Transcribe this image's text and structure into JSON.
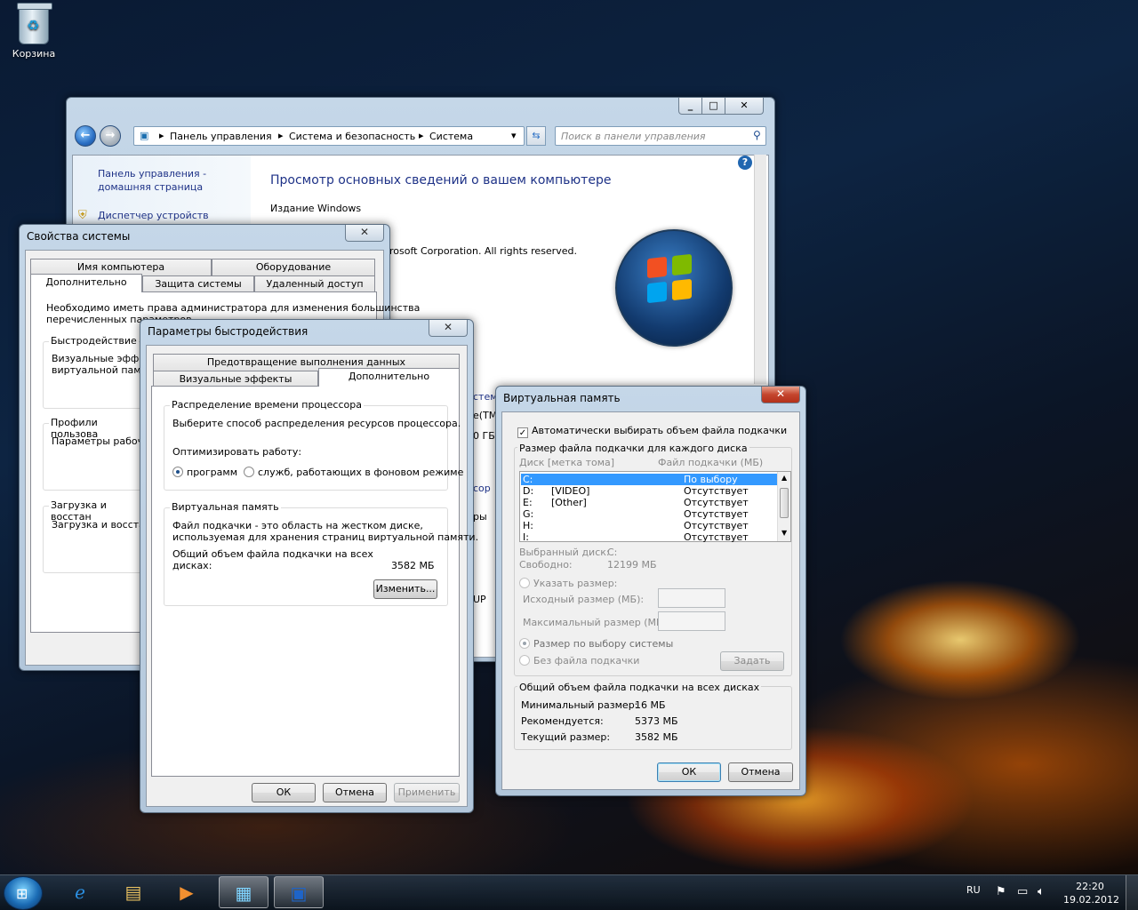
{
  "desktop": {
    "recycle_bin_label": "Корзина"
  },
  "explorer": {
    "breadcrumb": [
      "Панель управления",
      "Система и безопасность",
      "Система"
    ],
    "search_placeholder": "Поиск в панели управления",
    "sidebar": [
      "Панель управления -",
      "домашняя страница",
      "Диспетчер устройств"
    ],
    "heading": "Просмотр основных сведений о вашем компьютере",
    "edition_label": "Издание Windows",
    "copyright": "rosoft Corporation.  All rights reserved.",
    "partial": [
      "стем",
      "e(TM",
      "0 ГБ",
      "сор",
      "ры",
      "UP"
    ]
  },
  "sysprops": {
    "title": "Свойства системы",
    "tabs_row1": [
      "Имя компьютера",
      "Оборудование"
    ],
    "tabs_row2": [
      "Дополнительно",
      "Защита системы",
      "Удаленный доступ"
    ],
    "notice_line1": "Необходимо иметь права администратора для изменения большинства",
    "notice_line2": "перечисленных параметров",
    "perf_label": "Быстродействие",
    "perf_text1": "Визуальные эффе",
    "perf_text2": "виртуальной памя",
    "profiles_label": "Профили пользова",
    "profiles_text": "Параметры рабоче",
    "startup_label": "Загрузка и восстан",
    "startup_text": "Загрузка и восстан"
  },
  "perf": {
    "title": "Параметры быстродействия",
    "tab_dep": "Предотвращение выполнения данных",
    "tab_visual": "Визуальные эффекты",
    "tab_advanced": "Дополнительно",
    "cpu_group": "Распределение времени процессора",
    "cpu_text": "Выберите способ распределения ресурсов процессора.",
    "optimize_label": "Оптимизировать работу:",
    "opt_programs": "программ",
    "opt_services": "служб, работающих в фоновом режиме",
    "vm_group": "Виртуальная память",
    "vm_text1": "Файл подкачки - это область на жестком диске,",
    "vm_text2": "используемая для хранения страниц виртуальной памяти.",
    "vm_total1": "Общий объем файла подкачки на всех",
    "vm_total2": "дисках:",
    "vm_total_value": "3582 МБ",
    "change_btn": "Изменить...",
    "ok": "ОК",
    "cancel": "Отмена",
    "apply": "Применить"
  },
  "vmem": {
    "title": "Виртуальная память",
    "auto_label": "Автоматически выбирать объем файла подкачки",
    "size_group": "Размер файла подкачки для каждого диска",
    "col_disk": "Диск [метка тома]",
    "col_file": "Файл подкачки (МБ)",
    "disks": [
      {
        "drive": "C:",
        "label": "",
        "value": "По выбору системы"
      },
      {
        "drive": "D:",
        "label": "[VIDEO]",
        "value": "Отсутствует"
      },
      {
        "drive": "E:",
        "label": "[Other]",
        "value": "Отсутствует"
      },
      {
        "drive": "G:",
        "label": "",
        "value": "Отсутствует"
      },
      {
        "drive": "H:",
        "label": "",
        "value": "Отсутствует"
      },
      {
        "drive": "I:",
        "label": "",
        "value": "Отсутствует"
      }
    ],
    "selected_disk_label": "Выбранный диск:",
    "selected_disk_value": "C:",
    "free_label": "Свободно:",
    "free_value": "12199 МБ",
    "custom_size": "Указать размер:",
    "initial_size": "Исходный размер (МБ):",
    "max_size": "Максимальный размер (МБ):",
    "system_managed": "Размер по выбору системы",
    "no_paging": "Без файла подкачки",
    "set_btn": "Задать",
    "total_group": "Общий объем файла подкачки на всех дисках",
    "min_label": "Минимальный размер:",
    "min_value": "16 МБ",
    "rec_label": "Рекомендуется:",
    "rec_value": "5373 МБ",
    "cur_label": "Текущий размер:",
    "cur_value": "3582 МБ",
    "ok": "ОК",
    "cancel": "Отмена"
  },
  "taskbar": {
    "lang": "RU",
    "time": "22:20",
    "date": "19.02.2012"
  }
}
